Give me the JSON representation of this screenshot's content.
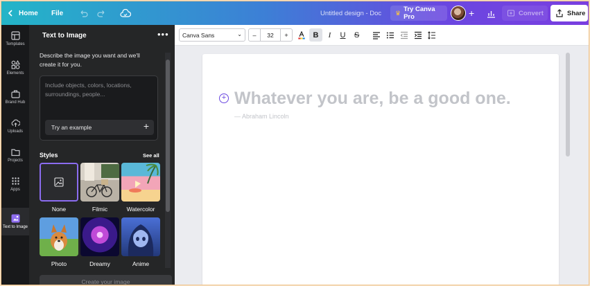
{
  "topbar": {
    "home_label": "Home",
    "file_label": "File",
    "doc_title": "Untitled design - Doc",
    "pro_label": "Try Canva Pro",
    "convert_label": "Convert",
    "share_label": "Share"
  },
  "rail": {
    "items": [
      {
        "label": "Templates",
        "icon": "templates-icon"
      },
      {
        "label": "Elements",
        "icon": "elements-icon"
      },
      {
        "label": "Brand Hub",
        "icon": "brand-hub-icon"
      },
      {
        "label": "Uploads",
        "icon": "uploads-icon"
      },
      {
        "label": "Projects",
        "icon": "projects-icon"
      },
      {
        "label": "Apps",
        "icon": "apps-icon"
      },
      {
        "label": "Text to Image",
        "icon": "text-to-image-icon"
      }
    ]
  },
  "panel": {
    "title": "Text to Image",
    "description": "Describe the image you want and we'll create it for you.",
    "prompt_placeholder": "Include objects, colors, locations, surroundings, people...",
    "try_example_label": "Try an example",
    "styles_label": "Styles",
    "see_all_label": "See all",
    "styles": [
      {
        "label": "None"
      },
      {
        "label": "Filmic"
      },
      {
        "label": "Watercolor"
      },
      {
        "label": "Photo"
      },
      {
        "label": "Dreamy"
      },
      {
        "label": "Anime"
      }
    ],
    "create_label": "Create your image"
  },
  "toolbar": {
    "font_family": "Canva Sans",
    "font_size": "32"
  },
  "canvas": {
    "quote": "Whatever you are, be a good one.",
    "author": "— Abraham Lincoln"
  },
  "colors": {
    "accent": "#7a3ee0",
    "panel_bg": "#252627",
    "rail_bg": "#18191b"
  }
}
